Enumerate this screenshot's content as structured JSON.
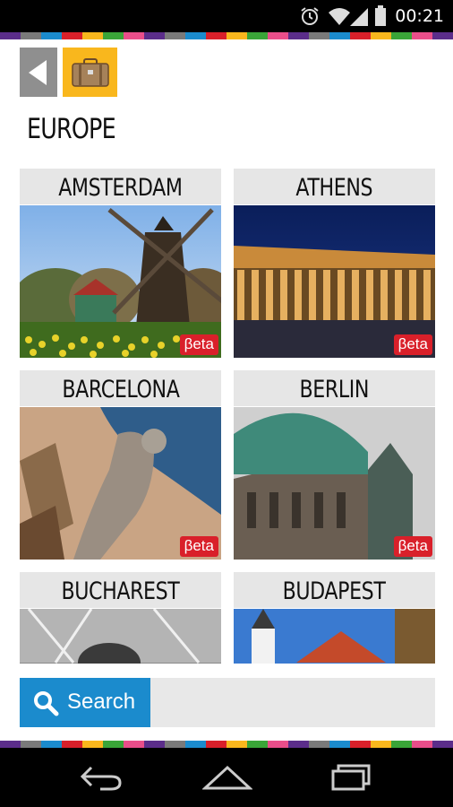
{
  "status_bar": {
    "time": "00:21"
  },
  "header": {
    "title": "EUROPE"
  },
  "stripe_colors": [
    "#5b2d8a",
    "#7a7a7a",
    "#1b8bcd",
    "#d9202a",
    "#f9b71d",
    "#3aa538",
    "#e94e8a",
    "#5b2d8a",
    "#7a7a7a",
    "#1b8bcd",
    "#d9202a",
    "#f9b71d",
    "#3aa538",
    "#e94e8a",
    "#5b2d8a",
    "#7a7a7a",
    "#1b8bcd",
    "#d9202a",
    "#f9b71d",
    "#3aa538",
    "#e94e8a",
    "#5b2d8a"
  ],
  "cities": [
    {
      "name": "AMSTERDAM",
      "badge": "βeta"
    },
    {
      "name": "ATHENS",
      "badge": "βeta"
    },
    {
      "name": "BARCELONA",
      "badge": "βeta"
    },
    {
      "name": "BERLIN",
      "badge": "βeta"
    },
    {
      "name": "BUCHAREST",
      "badge": ""
    },
    {
      "name": "BUDAPEST",
      "badge": ""
    }
  ],
  "search": {
    "label": "Search"
  },
  "icons": {
    "back": "back-arrow-icon",
    "suitcase": "suitcase-icon",
    "search": "search-icon",
    "alarm": "alarm-icon",
    "wifi": "wifi-icon",
    "signal": "signal-icon",
    "battery": "battery-icon",
    "nav_back": "nav-back-icon",
    "nav_home": "nav-home-icon",
    "nav_recents": "nav-recents-icon"
  }
}
